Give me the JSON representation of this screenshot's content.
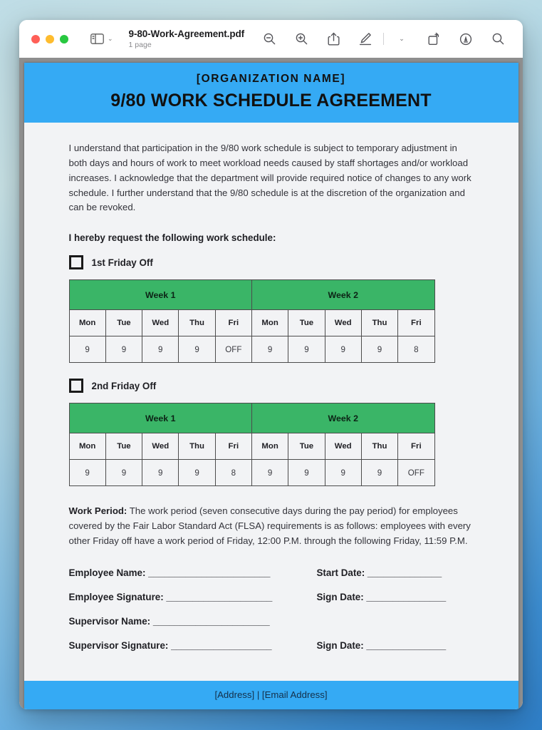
{
  "window": {
    "traffic_lights": [
      "close",
      "minimize",
      "zoom"
    ],
    "sidebar_toggle_chevron": "⌄",
    "document_title": "9-80-Work-Agreement.pdf",
    "page_count": "1 page",
    "toolbar": {
      "zoom_out": "zoom-out",
      "zoom_in": "zoom-in",
      "share": "share",
      "markup": "markup",
      "markup_chevron": "⌄",
      "rotate": "rotate",
      "annotate": "annotate",
      "search": "search"
    }
  },
  "document": {
    "header": {
      "organization": "[ORGANIZATION NAME]",
      "title": "9/80 WORK SCHEDULE AGREEMENT",
      "background_color": "#35aaf4"
    },
    "intro_paragraph": "I understand that participation in the 9/80 work schedule is subject to temporary adjustment in both days and hours of work to meet workload needs caused by staff shortages and/or workload increases. I acknowledge that the department will provide required notice of changes to any work schedule. I further understand that the 9/80 schedule is at the discretion of the organization and can be revoked.",
    "request_line": "I hereby request the following work schedule:",
    "options": [
      {
        "label": "1st Friday Off",
        "checked": false,
        "schedule": {
          "week_headers": [
            "Week 1",
            "Week 2"
          ],
          "days": [
            "Mon",
            "Tue",
            "Wed",
            "Thu",
            "Fri",
            "Mon",
            "Tue",
            "Wed",
            "Thu",
            "Fri"
          ],
          "hours": [
            "9",
            "9",
            "9",
            "9",
            "OFF",
            "9",
            "9",
            "9",
            "9",
            "8"
          ],
          "header_color": "#3ab567"
        }
      },
      {
        "label": "2nd Friday Off",
        "checked": false,
        "schedule": {
          "week_headers": [
            "Week 1",
            "Week 2"
          ],
          "days": [
            "Mon",
            "Tue",
            "Wed",
            "Thu",
            "Fri",
            "Mon",
            "Tue",
            "Wed",
            "Thu",
            "Fri"
          ],
          "hours": [
            "9",
            "9",
            "9",
            "9",
            "8",
            "9",
            "9",
            "9",
            "9",
            "OFF"
          ],
          "header_color": "#3ab567"
        }
      }
    ],
    "work_period": {
      "label": "Work Period:",
      "text": " The work period (seven consecutive days during the pay period) for employees covered by the Fair Labor Standard Act (FLSA) requirements is as follows: employees with every other Friday off have a work period of Friday, 12:00 P.M. through the following Friday, 11:59 P.M."
    },
    "signature_fields": {
      "employee_name": "Employee Name: _______________________",
      "start_date": "Start Date: ______________",
      "employee_signature": "Employee Signature: ____________________",
      "sign_date_1": "Sign Date: _______________",
      "supervisor_name": "Supervisor Name: ______________________",
      "supervisor_blank": "",
      "supervisor_signature": "Supervisor Signature: ___________________",
      "sign_date_2": "Sign Date: _______________"
    },
    "footer": {
      "text": "[Address] | [Email Address]",
      "background_color": "#35aaf4"
    }
  }
}
